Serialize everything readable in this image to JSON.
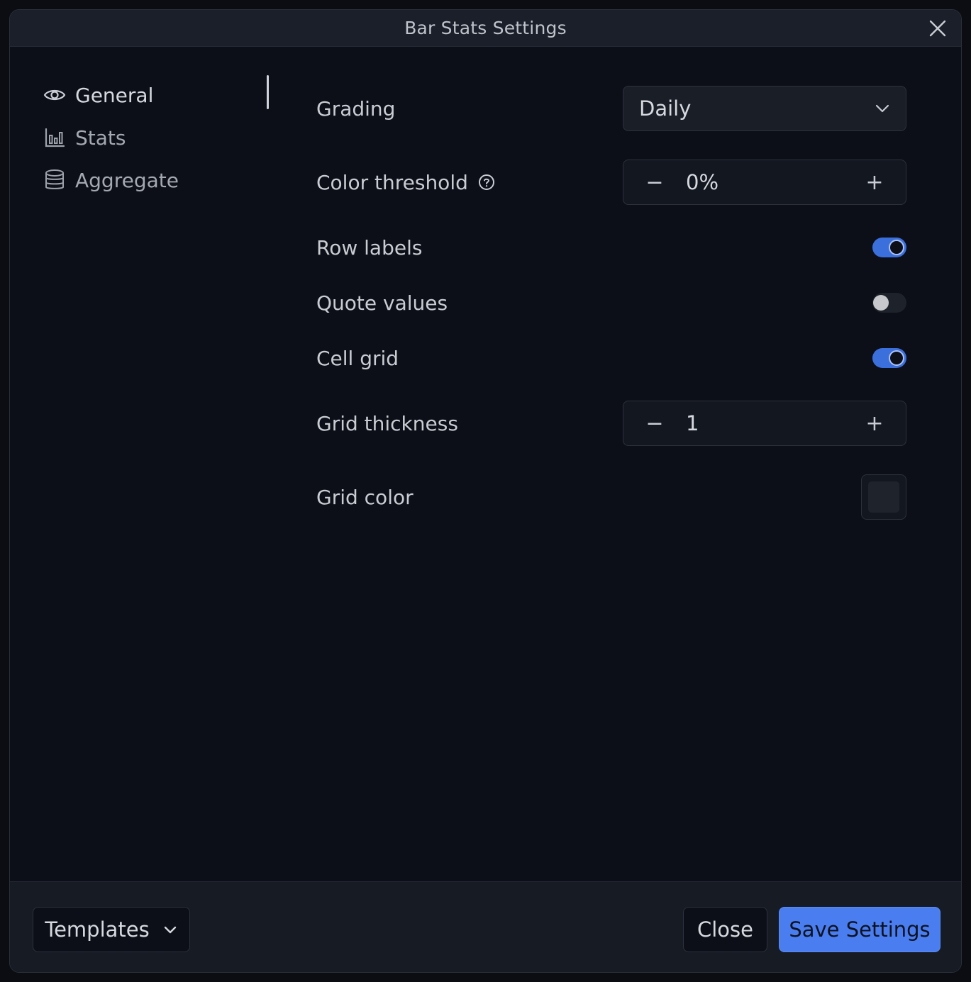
{
  "dialog": {
    "title": "Bar Stats Settings"
  },
  "sidebar": {
    "items": [
      {
        "label": "General",
        "icon": "eye-icon",
        "active": true
      },
      {
        "label": "Stats",
        "icon": "bar-chart-icon",
        "active": false
      },
      {
        "label": "Aggregate",
        "icon": "database-icon",
        "active": false
      }
    ]
  },
  "settings": {
    "grading": {
      "label": "Grading",
      "value": "Daily"
    },
    "color_threshold": {
      "label": "Color threshold",
      "value": "0%",
      "decrement": "−",
      "increment": "+"
    },
    "row_labels": {
      "label": "Row labels",
      "enabled": true
    },
    "quote_values": {
      "label": "Quote values",
      "enabled": false
    },
    "cell_grid": {
      "label": "Cell grid",
      "enabled": true
    },
    "grid_thickness": {
      "label": "Grid thickness",
      "value": "1",
      "decrement": "−",
      "increment": "+"
    },
    "grid_color": {
      "label": "Grid color",
      "color": "#1f232c"
    }
  },
  "footer": {
    "templates_label": "Templates",
    "close_label": "Close",
    "save_label": "Save Settings"
  },
  "colors": {
    "accent": "#4a7ef0",
    "toggle_on": "#3b6fdc"
  }
}
